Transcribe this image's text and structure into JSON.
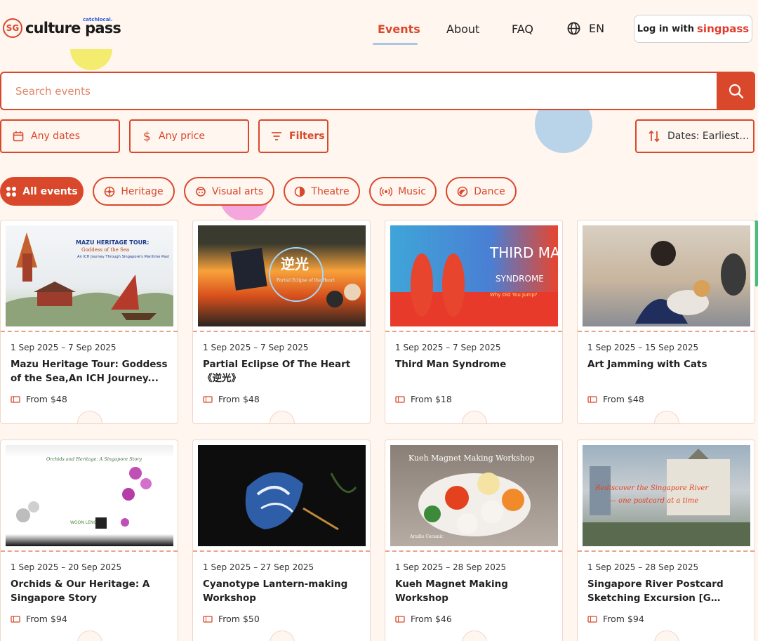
{
  "header": {
    "logo_badge": "SG",
    "logo_text": "culture pass",
    "logo_sub": "catchlocal.",
    "nav": {
      "events": "Events",
      "about": "About",
      "faq": "FAQ"
    },
    "lang": "EN",
    "login_prefix": "Log in with",
    "login_brand": "singpass"
  },
  "search": {
    "placeholder": "Search events"
  },
  "filters": {
    "dates": "Any dates",
    "price": "Any price",
    "filters": "Filters",
    "sort": "Dates: Earliest t..."
  },
  "categories": [
    "All events",
    "Heritage",
    "Visual arts",
    "Theatre",
    "Music",
    "Dance"
  ],
  "events": [
    {
      "date": "1 Sep 2025 – 7 Sep 2025",
      "title": "Mazu Heritage Tour: Goddess of the Sea,An ICH Journey...",
      "price": "From $48",
      "img_title": "MAZU HERITAGE TOUR:",
      "img_sub": "Goddess of the Sea",
      "img_sub2": "An ICH Journey Through Singapore's Maritime Past"
    },
    {
      "date": "1 Sep 2025 – 7 Sep 2025",
      "title": "Partial Eclipse Of The Heart 《逆光》",
      "price": "From $48",
      "img_title": "逆光",
      "img_sub": "Partial Eclipse of the Heart"
    },
    {
      "date": "1 Sep 2025 – 7 Sep 2025",
      "title": "Third Man Syndrome",
      "price": "From $18",
      "img_title": "THIRD MAN",
      "img_sub": "SYNDROME",
      "img_sub2": "Why Did You Jump?"
    },
    {
      "date": "1 Sep 2025 – 15 Sep 2025",
      "title": "Art Jamming with Cats",
      "price": "From $48"
    },
    {
      "date": "1 Sep 2025 – 20 Sep 2025",
      "title": "Orchids & Our Heritage: A Singapore Story",
      "price": "From $94",
      "img_title": "Orchids and Heritage: A Singapore Story",
      "img_sub": "WOON LENG"
    },
    {
      "date": "1 Sep 2025 – 27 Sep 2025",
      "title": "Cyanotype Lantern-making Workshop",
      "price": "From $50"
    },
    {
      "date": "1 Sep 2025 – 28 Sep 2025",
      "title": "Kueh Magnet Making Workshop",
      "price": "From $46",
      "img_title": "Kueh Magnet Making Workshop",
      "img_sub": "Arudio Ceramic"
    },
    {
      "date": "1 Sep 2025 – 28 Sep 2025",
      "title": "Singapore River Postcard Sketching Excursion [G (Childre...",
      "price": "From $94",
      "img_title": "Rediscover the Singapore River",
      "img_sub": "— one postcard at a time"
    }
  ],
  "colors": {
    "accent": "#d9482b",
    "background": "#fff6f0",
    "nav_underline": "#a9c6e3"
  }
}
